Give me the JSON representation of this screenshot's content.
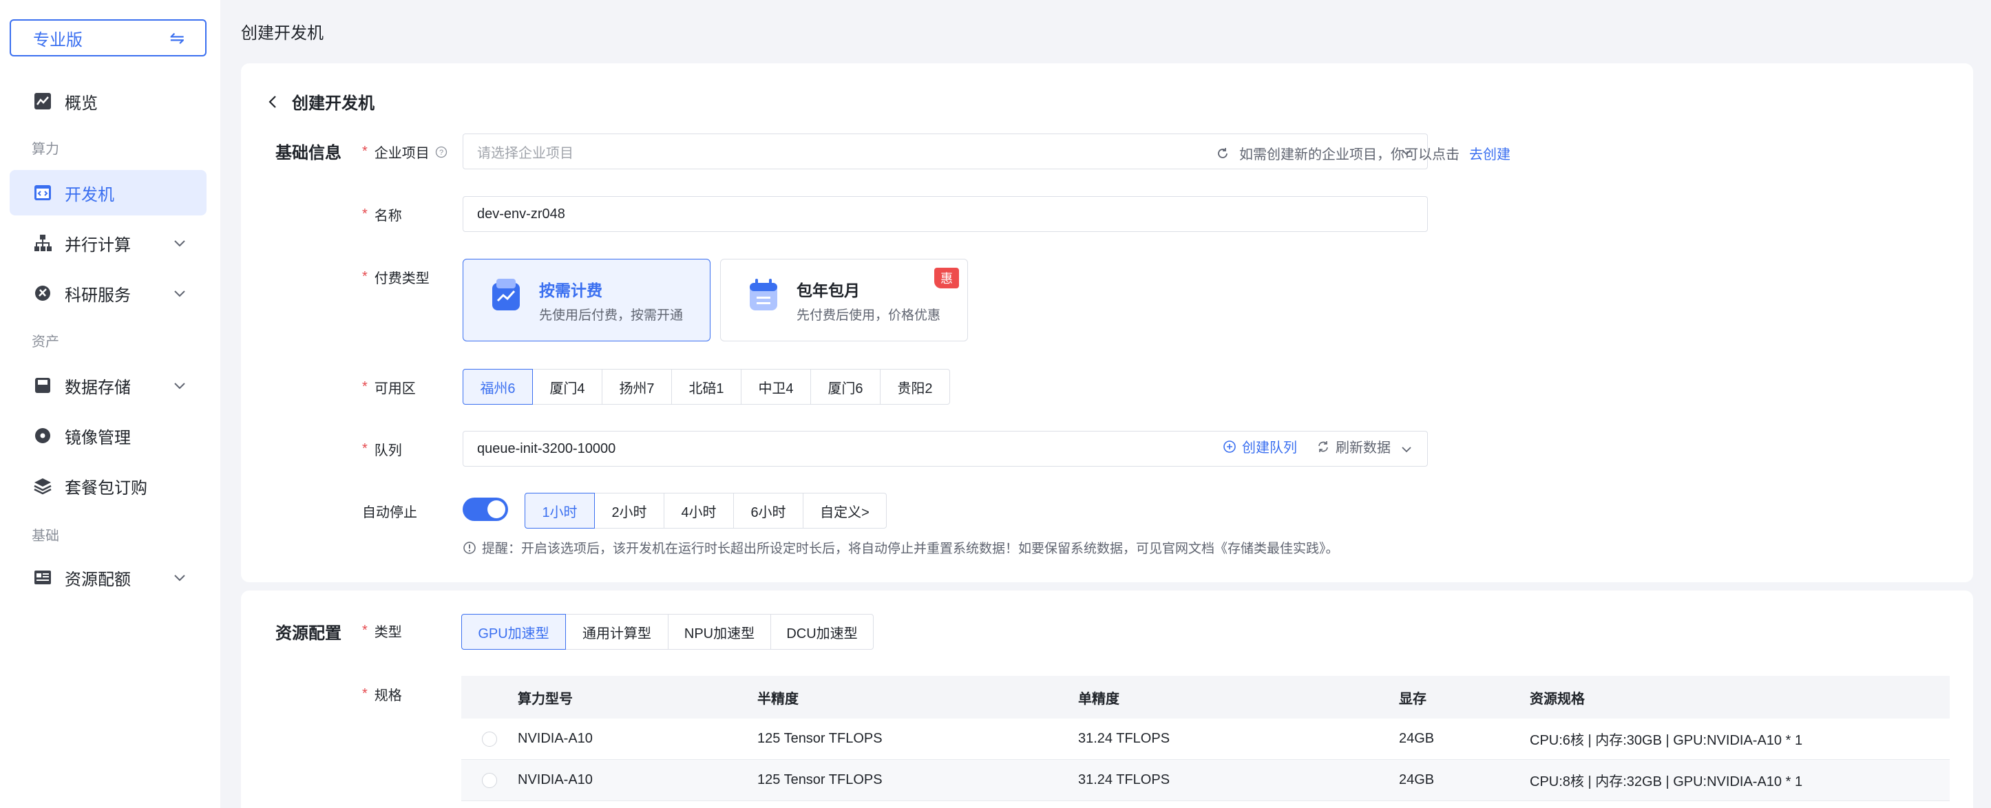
{
  "sidebar": {
    "edition_label": "专业版",
    "items": [
      {
        "label": "概览",
        "icon": "chart-icon"
      },
      {
        "label": "开发机",
        "icon": "code-icon"
      },
      {
        "label": "并行计算",
        "icon": "sitemap-icon"
      },
      {
        "label": "科研服务",
        "icon": "science-icon"
      },
      {
        "label": "数据存储",
        "icon": "storage-icon"
      },
      {
        "label": "镜像管理",
        "icon": "disc-icon"
      },
      {
        "label": "套餐包订购",
        "icon": "layers-icon"
      },
      {
        "label": "资源配额",
        "icon": "quota-icon"
      }
    ],
    "sections": [
      "算力",
      "资产",
      "基础"
    ],
    "active_item": "开发机"
  },
  "header": {
    "breadcrumb": "创建开发机"
  },
  "form": {
    "back_title": "创建开发机",
    "basic_section_title": "基础信息",
    "enterprise_project": {
      "label": "企业项目",
      "placeholder": "请选择企业项目",
      "hint": "如需创建新的企业项目，你可以点击",
      "hint_link": "去创建"
    },
    "name": {
      "label": "名称",
      "value": "dev-env-zr048"
    },
    "billing": {
      "label": "付费类型",
      "options": [
        {
          "title": "按需计费",
          "desc": "先使用后付费，按需开通",
          "selected": true
        },
        {
          "title": "包年包月",
          "desc": "先付费后使用，价格优惠",
          "badge": "惠",
          "selected": false
        }
      ]
    },
    "zone": {
      "label": "可用区",
      "options": [
        "福州6",
        "厦门4",
        "扬州7",
        "北碚1",
        "中卫4",
        "厦门6",
        "贵阳2"
      ],
      "selected": "福州6"
    },
    "queue": {
      "label": "队列",
      "value": "queue-init-3200-10000",
      "create_label": "创建队列",
      "refresh_label": "刷新数据"
    },
    "auto_stop": {
      "label": "自动停止",
      "enabled": true,
      "options": [
        "1小时",
        "2小时",
        "4小时",
        "6小时",
        "自定义>"
      ],
      "selected": "1小时",
      "warning": "提醒：开启该选项后，该开发机在运行时长超出所设定时长后，将自动停止并重置系统数据！如要保留系统数据，可见官网文档《存储类最佳实践》。"
    }
  },
  "resource": {
    "section_title": "资源配置",
    "type": {
      "label": "类型",
      "options": [
        "GPU加速型",
        "通用计算型",
        "NPU加速型",
        "DCU加速型"
      ],
      "selected": "GPU加速型"
    },
    "spec": {
      "label": "规格",
      "columns": [
        "算力型号",
        "半精度",
        "单精度",
        "显存",
        "资源规格"
      ],
      "rows": [
        [
          "NVIDIA-A10",
          "125 Tensor TFLOPS",
          "31.24 TFLOPS",
          "24GB",
          "CPU:6核 | 内存:30GB | GPU:NVIDIA-A10 * 1"
        ],
        [
          "NVIDIA-A10",
          "125 Tensor TFLOPS",
          "31.24 TFLOPS",
          "24GB",
          "CPU:8核 | 内存:32GB | GPU:NVIDIA-A10 * 1"
        ]
      ]
    }
  },
  "colors": {
    "primary": "#3a6ff0",
    "danger": "#ee4c4c",
    "active_bg": "#e6edff",
    "page_bg": "#f3f4f8"
  }
}
